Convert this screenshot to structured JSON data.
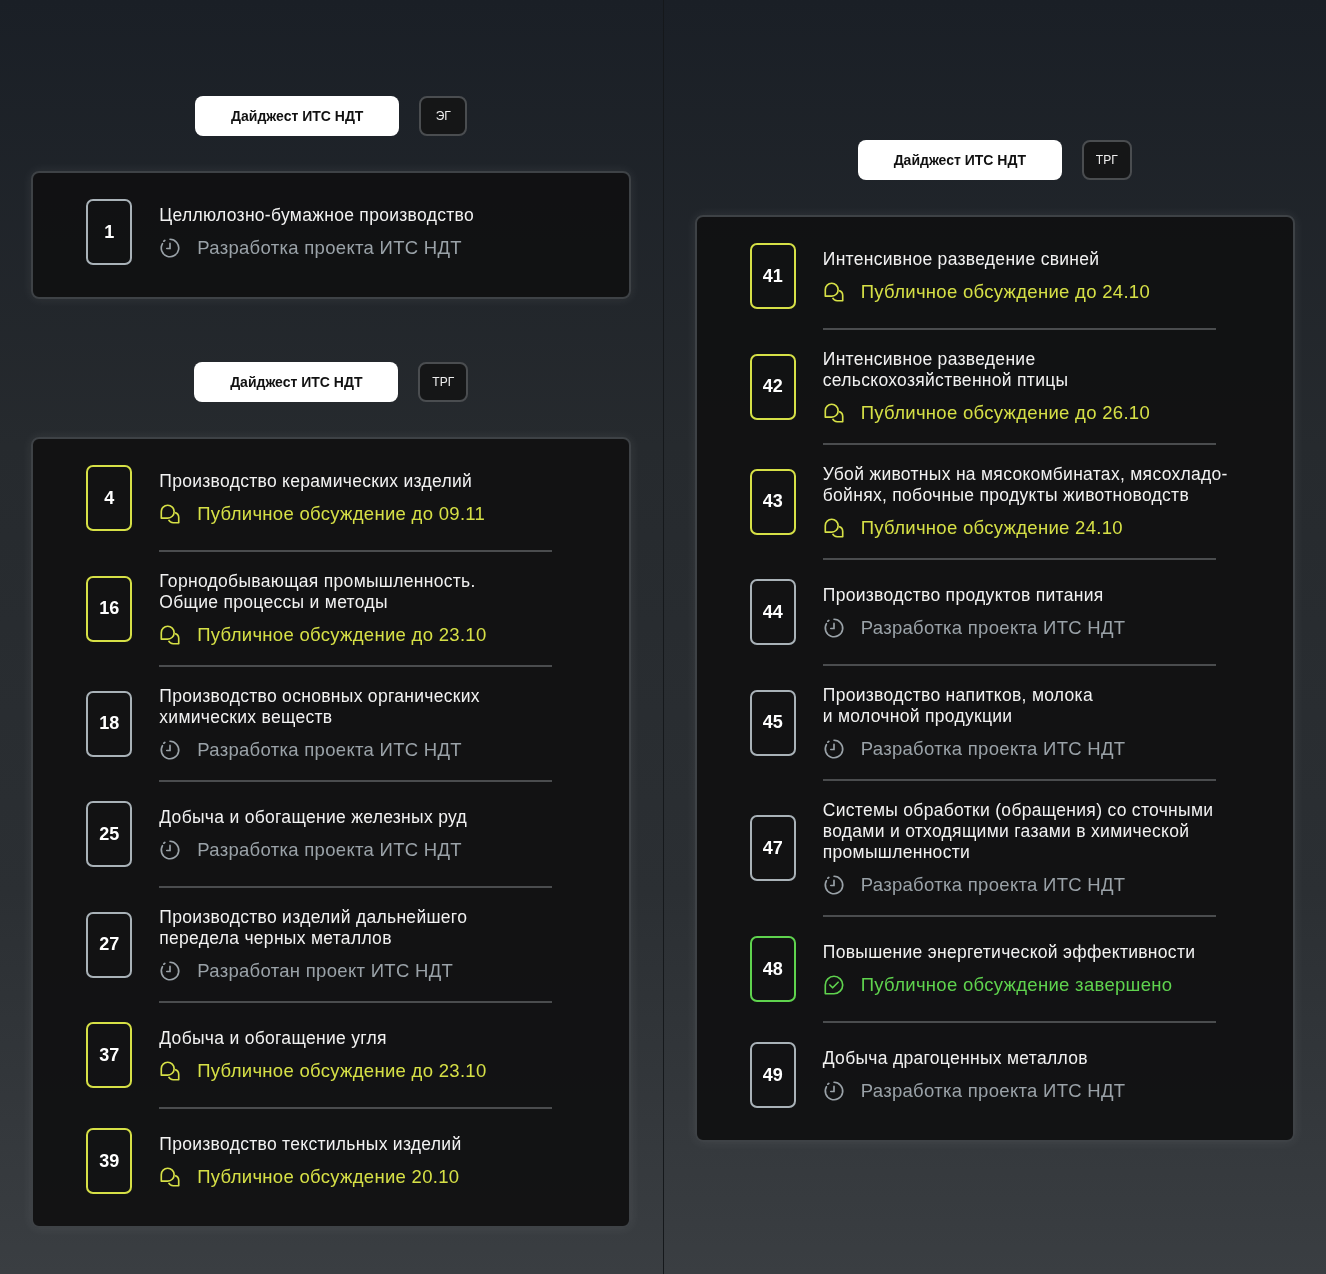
{
  "columns": [
    {
      "groups": [
        {
          "digest_button": "Дайджест ИТС НДТ",
          "tag": "ЭГ",
          "items": [
            {
              "number": "1",
              "title": [
                "Целлюлозно-бумажное производство"
              ],
              "status": "Разработка проекта ИТС НДТ",
              "kind": "draft"
            }
          ]
        },
        {
          "digest_button": "Дайджест ИТС НДТ",
          "tag": "ТРГ",
          "items": [
            {
              "number": "4",
              "title": [
                "Производство керамических изделий"
              ],
              "status": "Публичное обсуждение до 09.11",
              "kind": "discussion"
            },
            {
              "number": "16",
              "title": [
                "Горнодобывающая промышленность.",
                "Общие процессы и методы"
              ],
              "status": "Публичное обсуждение до 23.10",
              "kind": "discussion"
            },
            {
              "number": "18",
              "title": [
                "Производство основных органических",
                "химических веществ"
              ],
              "status": "Разработка проекта ИТС НДТ",
              "kind": "draft"
            },
            {
              "number": "25",
              "title": [
                "Добыча и обогащение железных руд"
              ],
              "status": "Разработка проекта ИТС НДТ",
              "kind": "draft"
            },
            {
              "number": "27",
              "title": [
                "Производство изделий дальнейшего",
                "передела черных металлов"
              ],
              "status": "Разработан проект ИТС НДТ",
              "kind": "draft"
            },
            {
              "number": "37",
              "title": [
                "Добыча и обогащение угля"
              ],
              "status": "Публичное обсуждение до 23.10",
              "kind": "discussion"
            },
            {
              "number": "39",
              "title": [
                "Производство текстильных изделий"
              ],
              "status": "Публичное обсуждение 20.10",
              "kind": "discussion"
            }
          ]
        }
      ]
    },
    {
      "groups": [
        {
          "digest_button": "Дайджест ИТС НДТ",
          "tag": "ТРГ",
          "items": [
            {
              "number": "41",
              "title": [
                "Интенсивное разведение свиней"
              ],
              "status": "Публичное обсуждение до 24.10",
              "kind": "discussion"
            },
            {
              "number": "42",
              "title": [
                "Интенсивное разведение",
                "сельскохозяйственной птицы"
              ],
              "status": "Публичное обсуждение до 26.10",
              "kind": "discussion"
            },
            {
              "number": "43",
              "title": [
                "Убой животных на мясокомбинатах, мясохладо-",
                "бойнях, побочные продукты животноводств"
              ],
              "status": "Публичное обсуждение 24.10",
              "kind": "discussion"
            },
            {
              "number": "44",
              "title": [
                "Производство продуктов питания"
              ],
              "status": "Разработка проекта ИТС НДТ",
              "kind": "draft"
            },
            {
              "number": "45",
              "title": [
                "Производство напитков, молока",
                "и молочной продукции"
              ],
              "status": "Разработка проекта ИТС НДТ",
              "kind": "draft"
            },
            {
              "number": "47",
              "title": [
                "Системы обработки (обращения) со сточными",
                "водами и отходящими газами в химической",
                "промышленности"
              ],
              "status": "Разработка проекта ИТС НДТ",
              "kind": "draft"
            },
            {
              "number": "48",
              "title": [
                "Повышение энергетической эффективности"
              ],
              "status": "Публичное обсуждение завершено",
              "kind": "done"
            },
            {
              "number": "49",
              "title": [
                "Добыча драгоценных металлов"
              ],
              "status": "Разработка проекта ИТС НДТ",
              "kind": "draft"
            }
          ]
        }
      ]
    }
  ]
}
